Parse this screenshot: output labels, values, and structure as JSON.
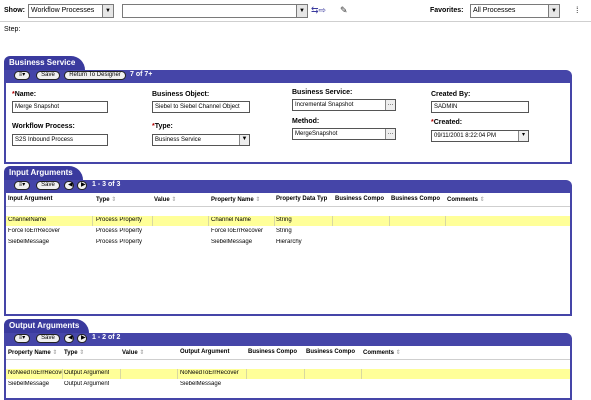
{
  "toolbar": {
    "show_label": "Show:",
    "show_value": "Workflow Processes",
    "search_value": "",
    "favorites_label": "Favorites:",
    "favorites_value": "All Processes",
    "dropdown_glyph": "▼",
    "icons": [
      "back-forward-icon",
      "edit-icon"
    ]
  },
  "step_label": "Step:",
  "business_service": {
    "tab": "Business Service",
    "menu_button": "≡▾",
    "save_button": "Save",
    "return_button": "Return To Designer",
    "record_count": "7 of 7+",
    "fields": {
      "name_label": "Name:",
      "name_value": "Merge Snapshot",
      "bo_label": "Business Object:",
      "bo_value": "Siebel to Siebel Channel Object",
      "bs_label": "Business Service:",
      "bs_value": "Incremental Snapshot",
      "created_by_label": "Created By:",
      "created_by_value": "SADMIN",
      "wp_label": "Workflow Process:",
      "wp_value": "S2S Inbound Process",
      "type_label": "Type:",
      "type_value": "Business Service",
      "method_label": "Method:",
      "method_value": "MergeSnapshot",
      "created_label": "Created:",
      "created_value": "09/11/2001 8:22:04 PM"
    }
  },
  "input_arguments": {
    "tab": "Input Arguments",
    "menu_button": "≡▾",
    "save_button": "Save",
    "count": "1 - 3 of 3",
    "columns": [
      "Input Argument",
      "Type",
      "Value",
      "Property Name",
      "Property Data Typ",
      "Business Compo",
      "Business Compo",
      "Comments"
    ],
    "rows": [
      [
        "ChannelName",
        "Process Property",
        "",
        "Channel Name",
        "String",
        "",
        "",
        ""
      ],
      [
        "ForceToErrRecover",
        "Process Property",
        "",
        "ForceToErrRecover",
        "String",
        "",
        "",
        ""
      ],
      [
        "SiebelMessage",
        "Process Property",
        "",
        "SiebelMessage",
        "Hierarchy",
        "",
        "",
        ""
      ]
    ]
  },
  "output_arguments": {
    "tab": "Output Arguments",
    "menu_button": "≡▾",
    "save_button": "Save",
    "count": "1 - 2 of 2",
    "columns": [
      "Property Name",
      "Type",
      "Value",
      "Output Argument",
      "Business Compo",
      "Business Compo",
      "Comments"
    ],
    "rows": [
      [
        "NoNeedToErrRecover",
        "Output Argument",
        "",
        "NoNeedToErrRecover",
        "",
        "",
        ""
      ],
      [
        "SiebelMessage",
        "Output Argument",
        "",
        "SiebelMessage",
        "",
        "",
        ""
      ]
    ]
  },
  "colors": {
    "tab_blue": "#3a3a9e",
    "bar_blue": "#4545a8",
    "selected_row": "#ffff99",
    "required": "#b00000"
  }
}
